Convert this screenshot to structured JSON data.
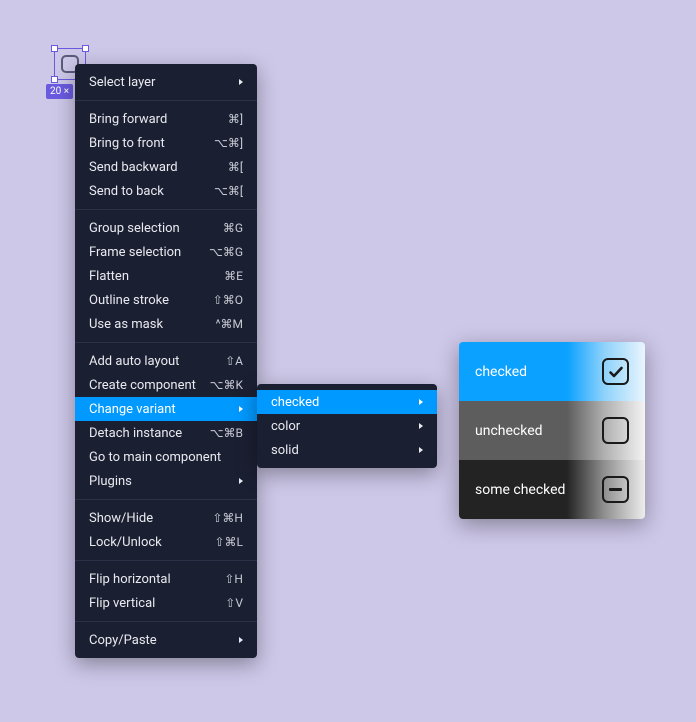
{
  "selection": {
    "size_badge": "20 ×"
  },
  "menu": {
    "select_layer": "Select layer",
    "bring_forward": {
      "label": "Bring forward",
      "shortcut": "⌘]"
    },
    "bring_to_front": {
      "label": "Bring to front",
      "shortcut": "⌥⌘]"
    },
    "send_backward": {
      "label": "Send backward",
      "shortcut": "⌘["
    },
    "send_to_back": {
      "label": "Send to back",
      "shortcut": "⌥⌘["
    },
    "group_selection": {
      "label": "Group selection",
      "shortcut": "⌘G"
    },
    "frame_selection": {
      "label": "Frame selection",
      "shortcut": "⌥⌘G"
    },
    "flatten": {
      "label": "Flatten",
      "shortcut": "⌘E"
    },
    "outline_stroke": {
      "label": "Outline stroke",
      "shortcut": "⇧⌘O"
    },
    "use_as_mask": {
      "label": "Use as mask",
      "shortcut": "^⌘M"
    },
    "add_auto_layout": {
      "label": "Add auto layout",
      "shortcut": "⇧A"
    },
    "create_component": {
      "label": "Create component",
      "shortcut": "⌥⌘K"
    },
    "change_variant": "Change variant",
    "detach_instance": {
      "label": "Detach instance",
      "shortcut": "⌥⌘B"
    },
    "go_to_main_component": "Go to main component",
    "plugins": "Plugins",
    "show_hide": {
      "label": "Show/Hide",
      "shortcut": "⇧⌘H"
    },
    "lock_unlock": {
      "label": "Lock/Unlock",
      "shortcut": "⇧⌘L"
    },
    "flip_horizontal": {
      "label": "Flip horizontal",
      "shortcut": "⇧H"
    },
    "flip_vertical": {
      "label": "Flip vertical",
      "shortcut": "⇧V"
    },
    "copy_paste": "Copy/Paste"
  },
  "submenu": {
    "checked": "checked",
    "color": "color",
    "solid": "solid"
  },
  "variants": {
    "checked": "checked",
    "unchecked": "unchecked",
    "some_checked": "some checked"
  }
}
